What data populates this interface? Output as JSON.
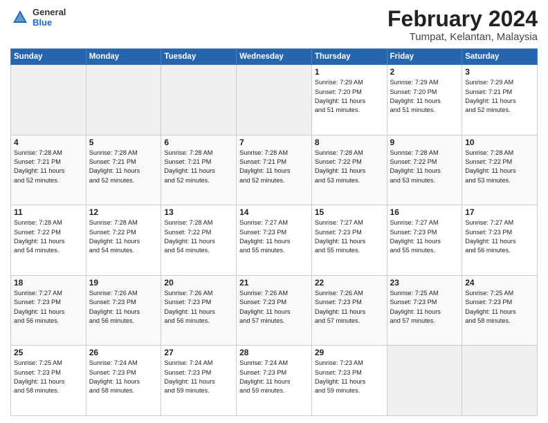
{
  "header": {
    "logo_general": "General",
    "logo_blue": "Blue",
    "month_title": "February 2024",
    "location": "Tumpat, Kelantan, Malaysia"
  },
  "days_of_week": [
    "Sunday",
    "Monday",
    "Tuesday",
    "Wednesday",
    "Thursday",
    "Friday",
    "Saturday"
  ],
  "weeks": [
    [
      {
        "day": "",
        "info": ""
      },
      {
        "day": "",
        "info": ""
      },
      {
        "day": "",
        "info": ""
      },
      {
        "day": "",
        "info": ""
      },
      {
        "day": "1",
        "info": "Sunrise: 7:29 AM\nSunset: 7:20 PM\nDaylight: 11 hours\nand 51 minutes."
      },
      {
        "day": "2",
        "info": "Sunrise: 7:29 AM\nSunset: 7:20 PM\nDaylight: 11 hours\nand 51 minutes."
      },
      {
        "day": "3",
        "info": "Sunrise: 7:29 AM\nSunset: 7:21 PM\nDaylight: 11 hours\nand 52 minutes."
      }
    ],
    [
      {
        "day": "4",
        "info": "Sunrise: 7:28 AM\nSunset: 7:21 PM\nDaylight: 11 hours\nand 52 minutes."
      },
      {
        "day": "5",
        "info": "Sunrise: 7:28 AM\nSunset: 7:21 PM\nDaylight: 11 hours\nand 52 minutes."
      },
      {
        "day": "6",
        "info": "Sunrise: 7:28 AM\nSunset: 7:21 PM\nDaylight: 11 hours\nand 52 minutes."
      },
      {
        "day": "7",
        "info": "Sunrise: 7:28 AM\nSunset: 7:21 PM\nDaylight: 11 hours\nand 52 minutes."
      },
      {
        "day": "8",
        "info": "Sunrise: 7:28 AM\nSunset: 7:22 PM\nDaylight: 11 hours\nand 53 minutes."
      },
      {
        "day": "9",
        "info": "Sunrise: 7:28 AM\nSunset: 7:22 PM\nDaylight: 11 hours\nand 53 minutes."
      },
      {
        "day": "10",
        "info": "Sunrise: 7:28 AM\nSunset: 7:22 PM\nDaylight: 11 hours\nand 53 minutes."
      }
    ],
    [
      {
        "day": "11",
        "info": "Sunrise: 7:28 AM\nSunset: 7:22 PM\nDaylight: 11 hours\nand 54 minutes."
      },
      {
        "day": "12",
        "info": "Sunrise: 7:28 AM\nSunset: 7:22 PM\nDaylight: 11 hours\nand 54 minutes."
      },
      {
        "day": "13",
        "info": "Sunrise: 7:28 AM\nSunset: 7:22 PM\nDaylight: 11 hours\nand 54 minutes."
      },
      {
        "day": "14",
        "info": "Sunrise: 7:27 AM\nSunset: 7:23 PM\nDaylight: 11 hours\nand 55 minutes."
      },
      {
        "day": "15",
        "info": "Sunrise: 7:27 AM\nSunset: 7:23 PM\nDaylight: 11 hours\nand 55 minutes."
      },
      {
        "day": "16",
        "info": "Sunrise: 7:27 AM\nSunset: 7:23 PM\nDaylight: 11 hours\nand 55 minutes."
      },
      {
        "day": "17",
        "info": "Sunrise: 7:27 AM\nSunset: 7:23 PM\nDaylight: 11 hours\nand 56 minutes."
      }
    ],
    [
      {
        "day": "18",
        "info": "Sunrise: 7:27 AM\nSunset: 7:23 PM\nDaylight: 11 hours\nand 56 minutes."
      },
      {
        "day": "19",
        "info": "Sunrise: 7:26 AM\nSunset: 7:23 PM\nDaylight: 11 hours\nand 56 minutes."
      },
      {
        "day": "20",
        "info": "Sunrise: 7:26 AM\nSunset: 7:23 PM\nDaylight: 11 hours\nand 56 minutes."
      },
      {
        "day": "21",
        "info": "Sunrise: 7:26 AM\nSunset: 7:23 PM\nDaylight: 11 hours\nand 57 minutes."
      },
      {
        "day": "22",
        "info": "Sunrise: 7:26 AM\nSunset: 7:23 PM\nDaylight: 11 hours\nand 57 minutes."
      },
      {
        "day": "23",
        "info": "Sunrise: 7:25 AM\nSunset: 7:23 PM\nDaylight: 11 hours\nand 57 minutes."
      },
      {
        "day": "24",
        "info": "Sunrise: 7:25 AM\nSunset: 7:23 PM\nDaylight: 11 hours\nand 58 minutes."
      }
    ],
    [
      {
        "day": "25",
        "info": "Sunrise: 7:25 AM\nSunset: 7:23 PM\nDaylight: 11 hours\nand 58 minutes."
      },
      {
        "day": "26",
        "info": "Sunrise: 7:24 AM\nSunset: 7:23 PM\nDaylight: 11 hours\nand 58 minutes."
      },
      {
        "day": "27",
        "info": "Sunrise: 7:24 AM\nSunset: 7:23 PM\nDaylight: 11 hours\nand 59 minutes."
      },
      {
        "day": "28",
        "info": "Sunrise: 7:24 AM\nSunset: 7:23 PM\nDaylight: 11 hours\nand 59 minutes."
      },
      {
        "day": "29",
        "info": "Sunrise: 7:23 AM\nSunset: 7:23 PM\nDaylight: 11 hours\nand 59 minutes."
      },
      {
        "day": "",
        "info": ""
      },
      {
        "day": "",
        "info": ""
      }
    ]
  ]
}
